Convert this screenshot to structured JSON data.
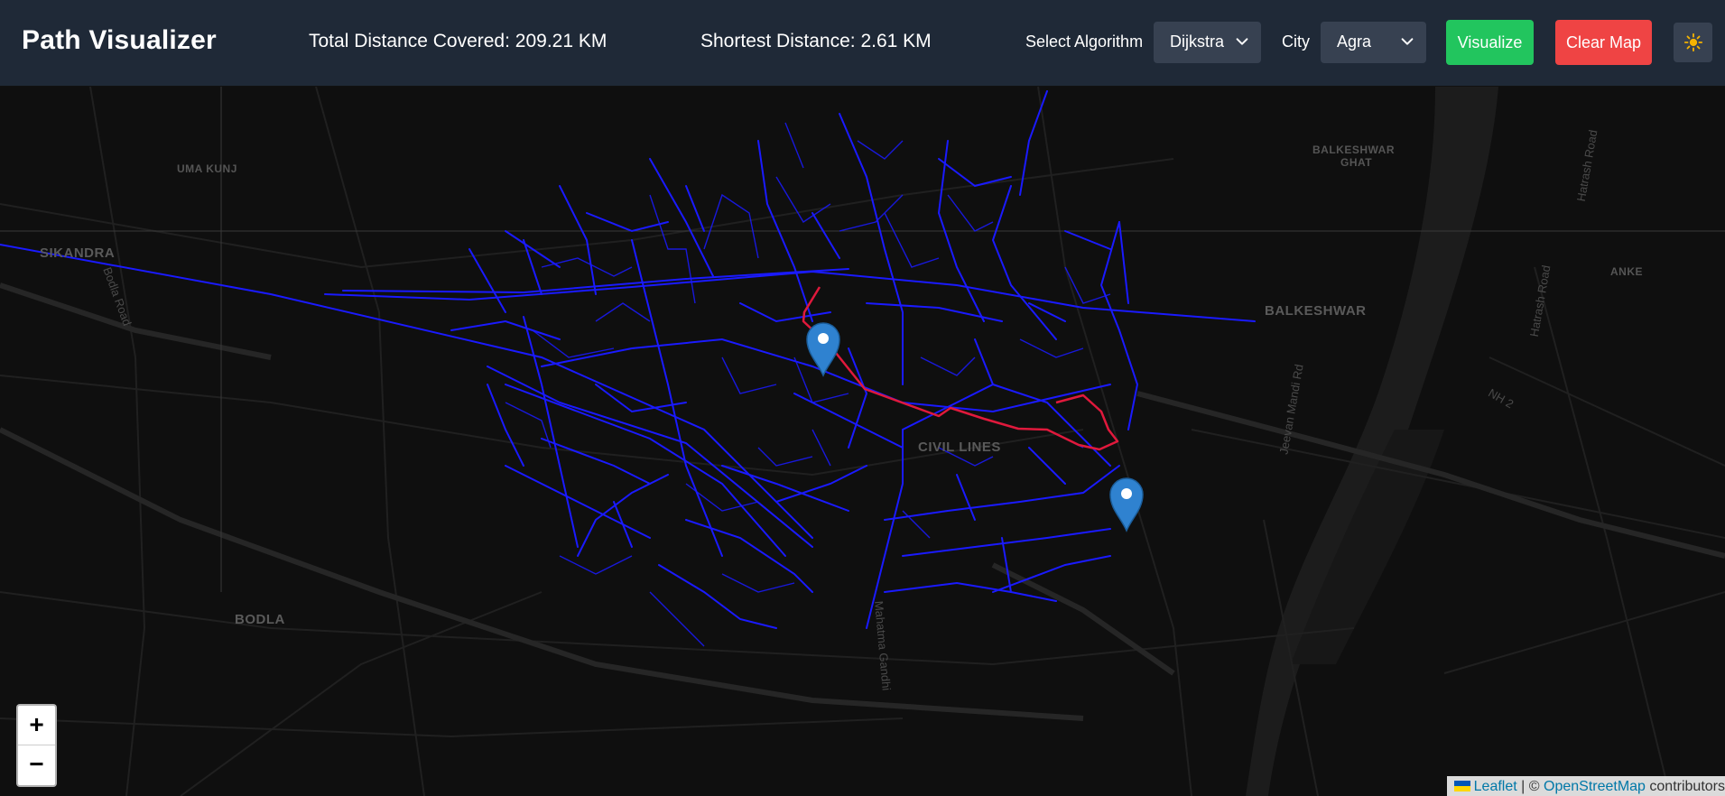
{
  "header": {
    "title": "Path Visualizer",
    "total_distance_label": "Total Distance Covered:",
    "total_distance_value": "209.21 KM",
    "shortest_distance_label": "Shortest Distance:",
    "shortest_distance_value": "2.61 KM",
    "algorithm_label": "Select Algorithm",
    "algorithm_selected": "Dijkstra",
    "city_label": "City",
    "city_selected": "Agra",
    "visualize_label": "Visualize",
    "clear_label": "Clear Map",
    "theme_icon": "sun-icon"
  },
  "colors": {
    "header_bg": "#1f2937",
    "select_bg": "#374151",
    "visualize": "#22c55e",
    "clear": "#ef4444",
    "explored_path": "#1a1aff",
    "shortest_path": "#e0193c",
    "marker": "#2f82d0"
  },
  "map": {
    "places": {
      "uma_kunj": "UMA KUNJ",
      "sikandra": "SIKANDRA",
      "balkeshwar_ghat_1": "BALKESHWAR",
      "balkeshwar_ghat_2": "GHAT",
      "balkeshwar": "BALKESHWAR",
      "anke": "ANKE",
      "civil_lines": "CIVIL LINES",
      "bodla": "BODLA"
    },
    "roads": {
      "bodla_road": "Bodla Road",
      "hatrash_road_1": "Hatrash Road",
      "hatrash_road_2": "Hatrash Road",
      "nh2": "NH 2",
      "jeevan_mandi": "Jeevan Mandi Rd",
      "mahatma_gandhi": "Mahatma Gandhi"
    },
    "zoom_in": "+",
    "zoom_out": "−",
    "attribution": {
      "leaflet": "Leaflet",
      "separator": "| ©",
      "osm": "OpenStreetMap",
      "contributors": "contributors"
    }
  }
}
